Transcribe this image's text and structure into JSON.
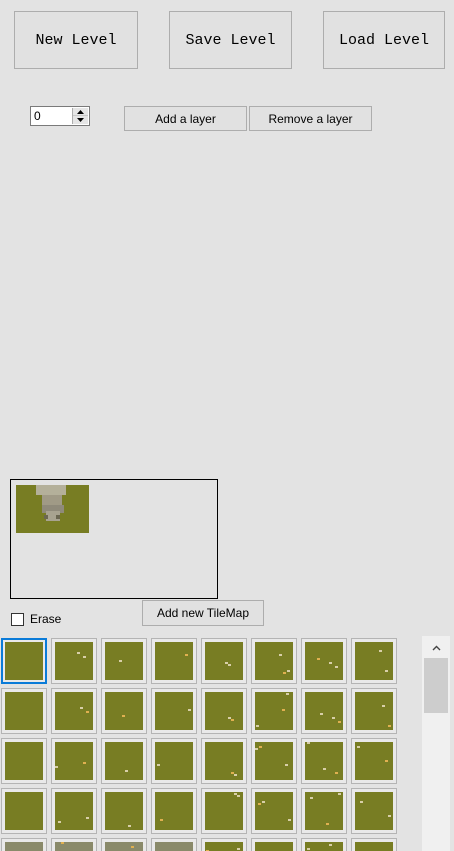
{
  "toolbar": {
    "new_level": "New Level",
    "save_level": "Save Level",
    "load_level": "Load Level"
  },
  "layer": {
    "value": "0",
    "add_label": "Add a layer",
    "remove_label": "Remove a layer"
  },
  "tilemap": {
    "erase_label": "Erase",
    "erase_checked": false,
    "add_label": "Add new TileMap"
  },
  "colors": {
    "grass": "#787d23",
    "selection": "#0a7bd8",
    "window_bg": "#e3e3e3"
  },
  "icons": {
    "spin_up": "triangle-up-icon",
    "spin_down": "triangle-down-icon",
    "scroll_up": "chevron-up-icon"
  }
}
